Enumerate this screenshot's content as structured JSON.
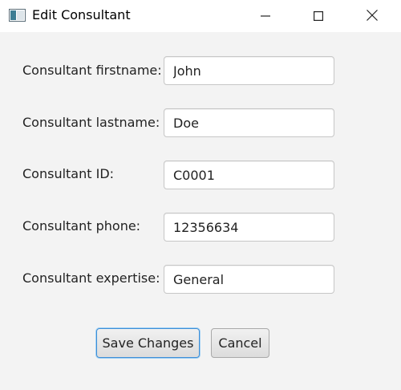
{
  "window": {
    "title": "Edit Consultant"
  },
  "form": {
    "rows": [
      {
        "label": "Consultant firstname:",
        "value": "John"
      },
      {
        "label": "Consultant lastname:",
        "value": "Doe"
      },
      {
        "label": "Consultant ID:",
        "value": "C0001"
      },
      {
        "label": "Consultant phone:",
        "value": "12356634"
      },
      {
        "label": "Consultant expertise:",
        "value": "General"
      }
    ]
  },
  "buttons": {
    "save_label": "Save Changes",
    "cancel_label": "Cancel"
  },
  "icons": {
    "app": "window-app-icon",
    "minimize": "minimize-icon",
    "maximize": "maximize-icon",
    "close": "close-icon"
  },
  "colors": {
    "focus_border": "#3e8ed6",
    "window_bg": "#f3f3f3"
  }
}
